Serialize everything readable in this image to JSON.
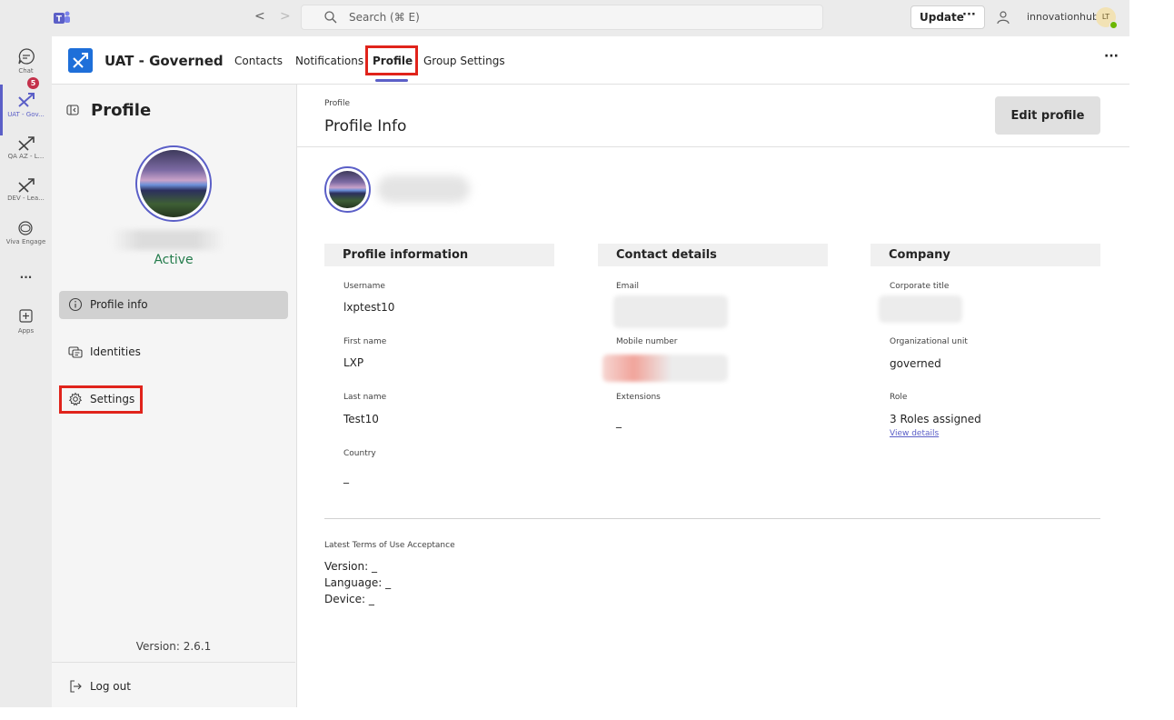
{
  "topbar": {
    "search_placeholder": "Search (⌘ E)",
    "update_label": "Update",
    "update_more": "···",
    "org_name": "innovationhub",
    "user_initials": "LT"
  },
  "rail": {
    "items": [
      {
        "label": "Chat",
        "badge": "5"
      },
      {
        "label": "UAT - Gov..."
      },
      {
        "label": "QA AZ - L..."
      },
      {
        "label": "DEV - Lea..."
      },
      {
        "label": "Viva Engage"
      },
      {
        "label": "···"
      },
      {
        "label": "Apps"
      }
    ]
  },
  "app": {
    "title": "UAT - Governed",
    "tabs": [
      {
        "label": "Contacts"
      },
      {
        "label": "Notifications"
      },
      {
        "label": "Profile",
        "active": true
      },
      {
        "label": "Group Settings"
      }
    ],
    "more": "···"
  },
  "sidebar": {
    "title": "Profile",
    "status": "Active",
    "nav": [
      {
        "label": "Profile info",
        "active": true
      },
      {
        "label": "Identities"
      },
      {
        "label": "Settings"
      }
    ],
    "version": "Version: 2.6.1",
    "logout": "Log out"
  },
  "main": {
    "breadcrumb": "Profile",
    "title": "Profile Info",
    "edit_button": "Edit profile",
    "sections": {
      "profile": {
        "title": "Profile information",
        "fields": [
          {
            "label": "Username",
            "value": "lxptest10"
          },
          {
            "label": "First name",
            "value": "LXP"
          },
          {
            "label": "Last name",
            "value": "Test10"
          },
          {
            "label": "Country",
            "value": "_"
          }
        ]
      },
      "contact": {
        "title": "Contact details",
        "fields": [
          {
            "label": "Email",
            "value": ""
          },
          {
            "label": "Mobile number",
            "value": ""
          },
          {
            "label": "Extensions",
            "value": "_"
          }
        ]
      },
      "company": {
        "title": "Company",
        "fields": [
          {
            "label": "Corporate title",
            "value": ""
          },
          {
            "label": "Organizational unit",
            "value": "governed"
          },
          {
            "label": "Role",
            "value": "3 Roles assigned",
            "link": "View details"
          }
        ]
      }
    },
    "terms": {
      "heading": "Latest Terms of Use Acceptance",
      "version": "Version: _",
      "language": "Language: _",
      "device": "Device: _"
    }
  },
  "colors": {
    "accent": "#5b5fc7",
    "highlight": "#e0231b",
    "status_active": "#237b4b",
    "badge": "#c4314b"
  }
}
